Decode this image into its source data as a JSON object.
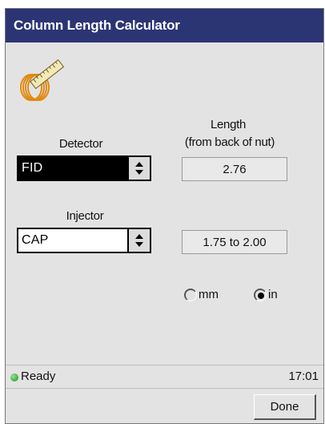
{
  "window": {
    "title": "Column Length Calculator"
  },
  "icons": {
    "app": "coiled-column-with-ruler-icon",
    "spinner": "up-down-arrows-icon"
  },
  "detector": {
    "label": "Detector",
    "value": "FID"
  },
  "injector": {
    "label": "Injector",
    "value": "CAP"
  },
  "length": {
    "header_line1": "Length",
    "header_line2": "(from back of nut)",
    "detector_value": "2.76",
    "injector_value": "1.75 to 2.00"
  },
  "units": {
    "options": [
      {
        "label": "mm",
        "selected": false
      },
      {
        "label": "in",
        "selected": true
      }
    ]
  },
  "status": {
    "text": "Ready",
    "time": "17:01",
    "indicator_color": "#2aa52a"
  },
  "buttons": {
    "done": "Done"
  },
  "colors": {
    "titlebar": "#2c3574",
    "window_bg": "#e3e3e3"
  }
}
